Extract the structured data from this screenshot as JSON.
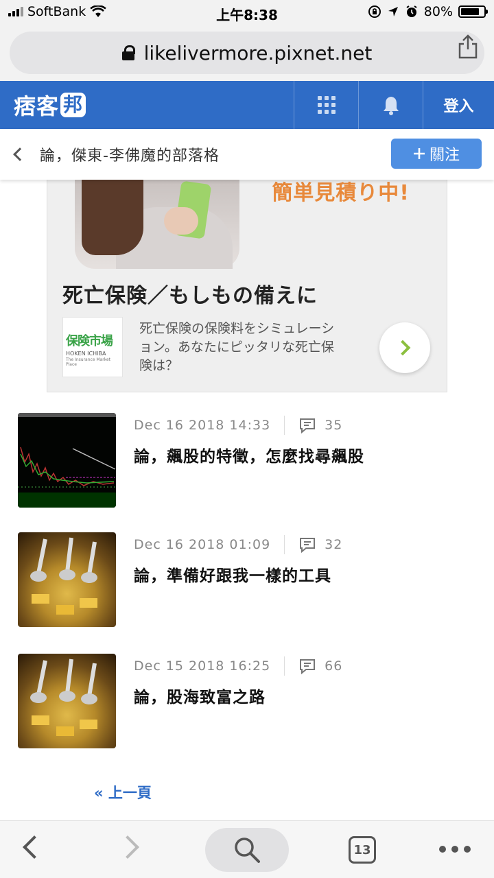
{
  "status_bar": {
    "carrier": "SoftBank",
    "time": "上午8:38",
    "battery": "80%",
    "battery_level": 0.8
  },
  "url_bar": {
    "domain": "likelivermore.pixnet.net"
  },
  "header": {
    "logo": "痞客",
    "logo_mark": "邦",
    "login_label": "登入"
  },
  "blog_bar": {
    "title": "論，傑東-李佛魔的部落格",
    "follow_label": "關注"
  },
  "ad": {
    "headline": "簡単見積り中!",
    "title": "死亡保険／もしもの備えに",
    "logo_jp": "保険市場",
    "logo_en": "HOKEN ICHIBA",
    "logo_sub": "The Insurance Market Place",
    "description": "死亡保険の保険料をシミュレーション。あなたにピッタリな死亡保険は？"
  },
  "posts": [
    {
      "date": "Dec 16 2018 14:33",
      "comments": "35",
      "title": "論，飆股的特徵，怎麼找尋飆股",
      "thumb": "stock-chart"
    },
    {
      "date": "Dec 16 2018 01:09",
      "comments": "32",
      "title": "論，準備好跟我一樣的工具",
      "thumb": "gold-coins"
    },
    {
      "date": "Dec 15 2018 16:25",
      "comments": "66",
      "title": "論，股海致富之路",
      "thumb": "gold-coins"
    }
  ],
  "pagination": {
    "prev_label": "« 上一頁"
  },
  "toolbar": {
    "tab_count": "13"
  }
}
